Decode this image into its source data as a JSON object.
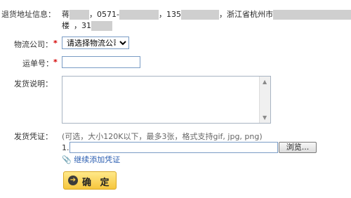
{
  "address": {
    "label": "退货地址信息：",
    "part1": "蒋",
    "part2": "，0571-",
    "part3": "，135",
    "part4": "，浙江省杭州市",
    "line2_a": "楼",
    "line2_b": "，31"
  },
  "company": {
    "required_mark": "*",
    "label": "物流公司：",
    "selected": "请选择物流公司"
  },
  "waybill": {
    "required_mark": "*",
    "label": "运单号：",
    "value": ""
  },
  "shipping_desc": {
    "label": "发货说明：",
    "value": ""
  },
  "voucher": {
    "label": "发货凭证：",
    "hint": "(可选，大小120K以下，最多3张，格式支持gif, jpg, png)",
    "index": "1.",
    "browse_label": "浏览...",
    "add_more": "继续添加凭证"
  },
  "confirm": {
    "label": "确 定"
  }
}
